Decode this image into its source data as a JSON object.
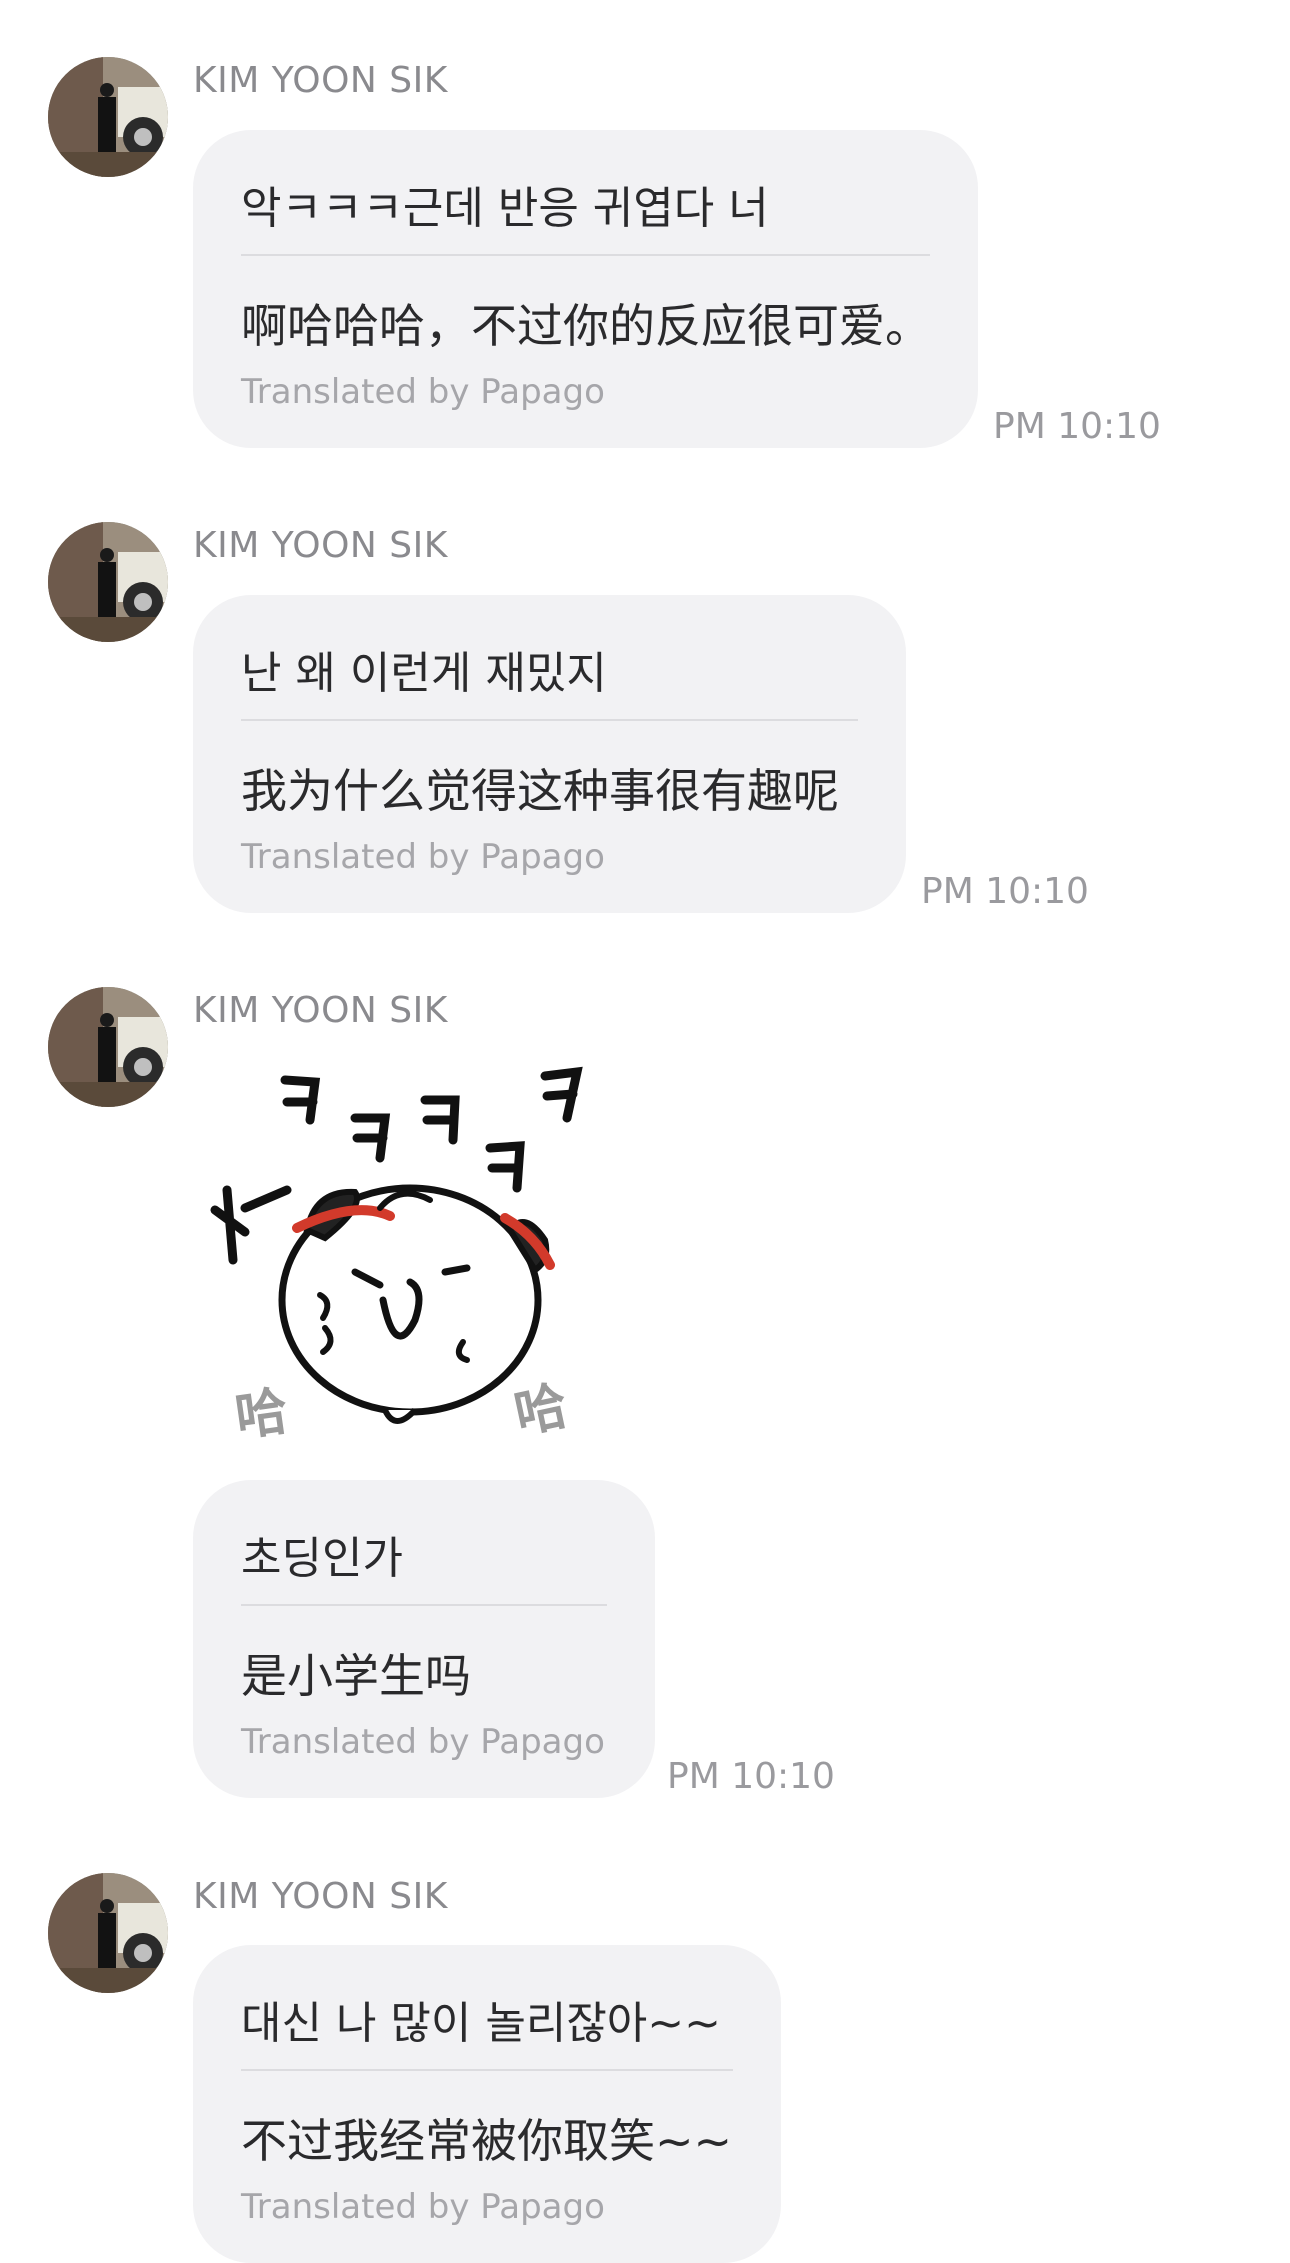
{
  "messages": [
    {
      "sender": "KIM YOON SIK",
      "original": "악ㅋㅋㅋ근데 반응 귀엽다 너",
      "translation": "啊哈哈哈，不过你的反应很可爱。",
      "credit": "Translated by Papago",
      "time": "PM 10:10"
    },
    {
      "sender": "KIM YOON SIK",
      "original": "난 왜 이런게 재밌지",
      "translation": "我为什么觉得这种事很有趣呢",
      "credit": "Translated by Papago",
      "time": "PM 10:10"
    },
    {
      "sender": "KIM YOON SIK",
      "sticker": {
        "icon": "laughing-dumpling-sticker",
        "text_top": "ㅋㅋㅋㅋ",
        "text_side": "哈"
      },
      "original": "초딩인가",
      "translation": "是小学生吗",
      "credit": "Translated by Papago",
      "time": "PM 10:10"
    },
    {
      "sender": "KIM YOON SIK",
      "original": "대신 나 많이 놀리잖아~~",
      "translation": "不过我经常被你取笑~~",
      "credit": "Translated by Papago"
    }
  ],
  "colors": {
    "bubble": "#f2f2f4",
    "sender": "#8a8a8e",
    "credit": "#a6a6aa",
    "time": "#9a9a9e"
  }
}
